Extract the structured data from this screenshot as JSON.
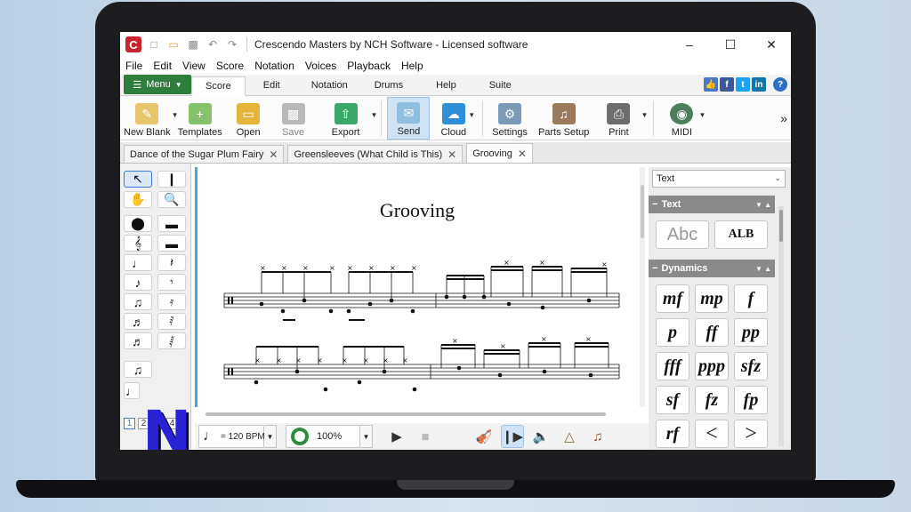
{
  "app": {
    "title": "Crescendo Masters by NCH Software - Licensed software",
    "logo_letter": "C"
  },
  "menubar": [
    "File",
    "Edit",
    "View",
    "Score",
    "Notation",
    "Voices",
    "Playback",
    "Help"
  ],
  "ribbon": {
    "menu_label": "Menu",
    "tabs": [
      "Score",
      "Edit",
      "Notation",
      "Drums",
      "Help",
      "Suite"
    ],
    "active_tab": "Score"
  },
  "toolbar": {
    "buttons": [
      {
        "label": "New Blank",
        "icon": "new-blank-icon",
        "color": "#e8c46a"
      },
      {
        "label": "Templates",
        "icon": "templates-icon",
        "color": "#86c26b"
      },
      {
        "label": "Open",
        "icon": "open-folder-icon",
        "color": "#e5b43a"
      },
      {
        "label": "Save",
        "icon": "save-icon",
        "color": "#b9b9b9"
      },
      {
        "label": "Export",
        "icon": "export-icon",
        "color": "#3aa86a"
      },
      {
        "label": "Send",
        "icon": "send-envelope-icon",
        "color": "#8fbfe0"
      },
      {
        "label": "Cloud",
        "icon": "cloud-icon",
        "color": "#2f8fd8"
      },
      {
        "label": "Settings",
        "icon": "settings-icon",
        "color": "#7a9ab8"
      },
      {
        "label": "Parts Setup",
        "icon": "parts-setup-icon",
        "color": "#9a7a5a"
      },
      {
        "label": "Print",
        "icon": "print-icon",
        "color": "#6d6d6d"
      },
      {
        "label": "MIDI",
        "icon": "midi-icon",
        "color": "#4f7e5e"
      }
    ]
  },
  "doc_tabs": [
    {
      "label": "Dance of the Sugar Plum Fairy",
      "active": false
    },
    {
      "label": "Greensleeves (What Child is This)",
      "active": false
    },
    {
      "label": "Grooving",
      "active": true
    }
  ],
  "score": {
    "title": "Grooving"
  },
  "transport": {
    "tempo": "= 120 BPM",
    "volume": "100%"
  },
  "palette": {
    "page_tabs": [
      "1",
      "2",
      "3",
      "4"
    ],
    "active_page": "1",
    "logo_letter": "N"
  },
  "right_panel": {
    "select_value": "Text",
    "text_section": "Text",
    "dynamics_section": "Dynamics",
    "text_buttons": [
      "Abc",
      "ALB"
    ],
    "dynamics": [
      "mf",
      "mp",
      "f",
      "p",
      "ff",
      "pp",
      "fff",
      "ppp",
      "sfz",
      "sf",
      "fz",
      "fp",
      "rf",
      "<",
      ">"
    ]
  },
  "colors": {
    "menu_button": "#2f7d3b",
    "accent_blue": "#4aa3df",
    "section_header": "#8a8a8a",
    "laptop": "#1d1d1f"
  }
}
